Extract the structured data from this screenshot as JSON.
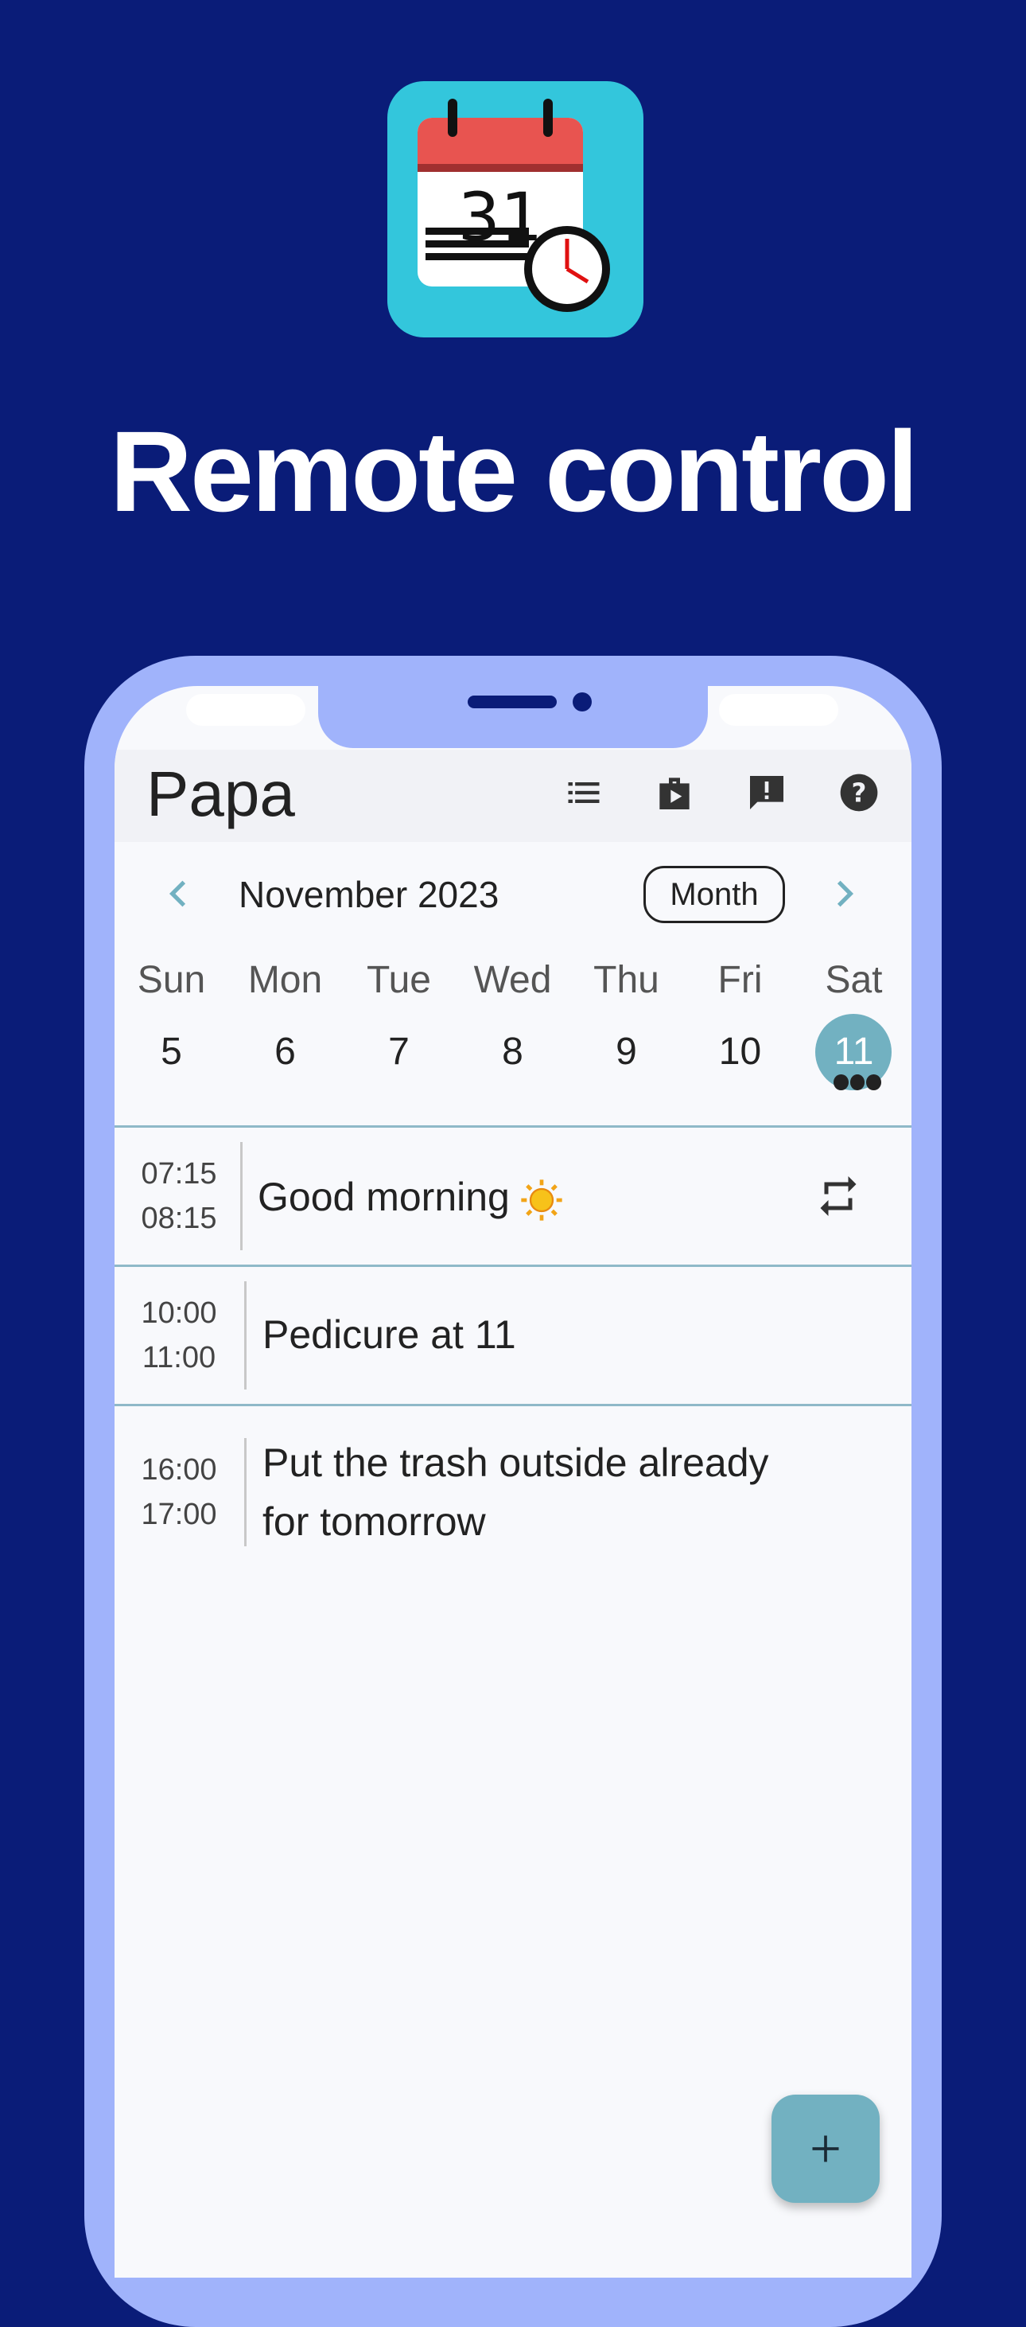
{
  "headline": "Remote control",
  "app_icon": {
    "day_number": "31",
    "name": "calendar-clock-icon"
  },
  "app_bar": {
    "title": "Papa",
    "actions": [
      "list-icon",
      "play-store-icon",
      "feedback-icon",
      "help-icon"
    ]
  },
  "calendar": {
    "month_label": "November 2023",
    "view_button": "Month",
    "days": [
      {
        "name": "Sun",
        "num": "5"
      },
      {
        "name": "Mon",
        "num": "6"
      },
      {
        "name": "Tue",
        "num": "7"
      },
      {
        "name": "Wed",
        "num": "8"
      },
      {
        "name": "Thu",
        "num": "9"
      },
      {
        "name": "Fri",
        "num": "10"
      },
      {
        "name": "Sat",
        "num": "11",
        "selected": true
      }
    ]
  },
  "events": [
    {
      "start": "07:15",
      "end": "08:15",
      "title": "Good morning",
      "emoji": "sun",
      "repeat": true
    },
    {
      "start": "10:00",
      "end": "11:00",
      "title": "Pedicure at 11"
    },
    {
      "start": "16:00",
      "end": "17:00",
      "title_line1": "Put the trash outside already",
      "title_line2": "for tomorrow"
    }
  ],
  "fab": {
    "label": "+"
  },
  "colors": {
    "background": "#0a1c78",
    "phone_frame": "#a0b3fb",
    "accent": "#72b1c1",
    "icon_bg": "#33c6dc",
    "calendar_header": "#e85450"
  }
}
